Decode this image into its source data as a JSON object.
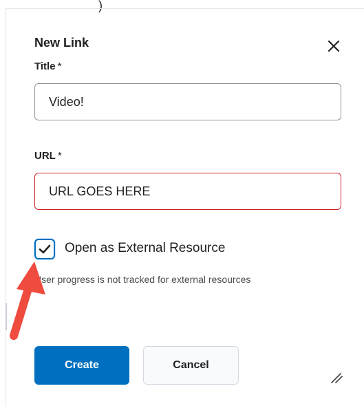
{
  "top_glyph": ")",
  "dialog": {
    "title": "New Link",
    "close_icon": "close-icon"
  },
  "fields": {
    "title": {
      "label": "Title",
      "required_mark": "*",
      "value": "Video!"
    },
    "url": {
      "label": "URL",
      "required_mark": "*",
      "value": "URL GOES HERE"
    }
  },
  "external": {
    "checked": true,
    "label": "Open as External Resource",
    "helper": "User progress is not tracked for external resources"
  },
  "buttons": {
    "create": "Create",
    "cancel": "Cancel"
  },
  "icons": {
    "resize": "resize-handle-icon",
    "annotation": "red-arrow-annotation"
  },
  "colors": {
    "primary": "#006fbf",
    "error_border": "#cd2026",
    "annotation": "#ef4b3f"
  }
}
